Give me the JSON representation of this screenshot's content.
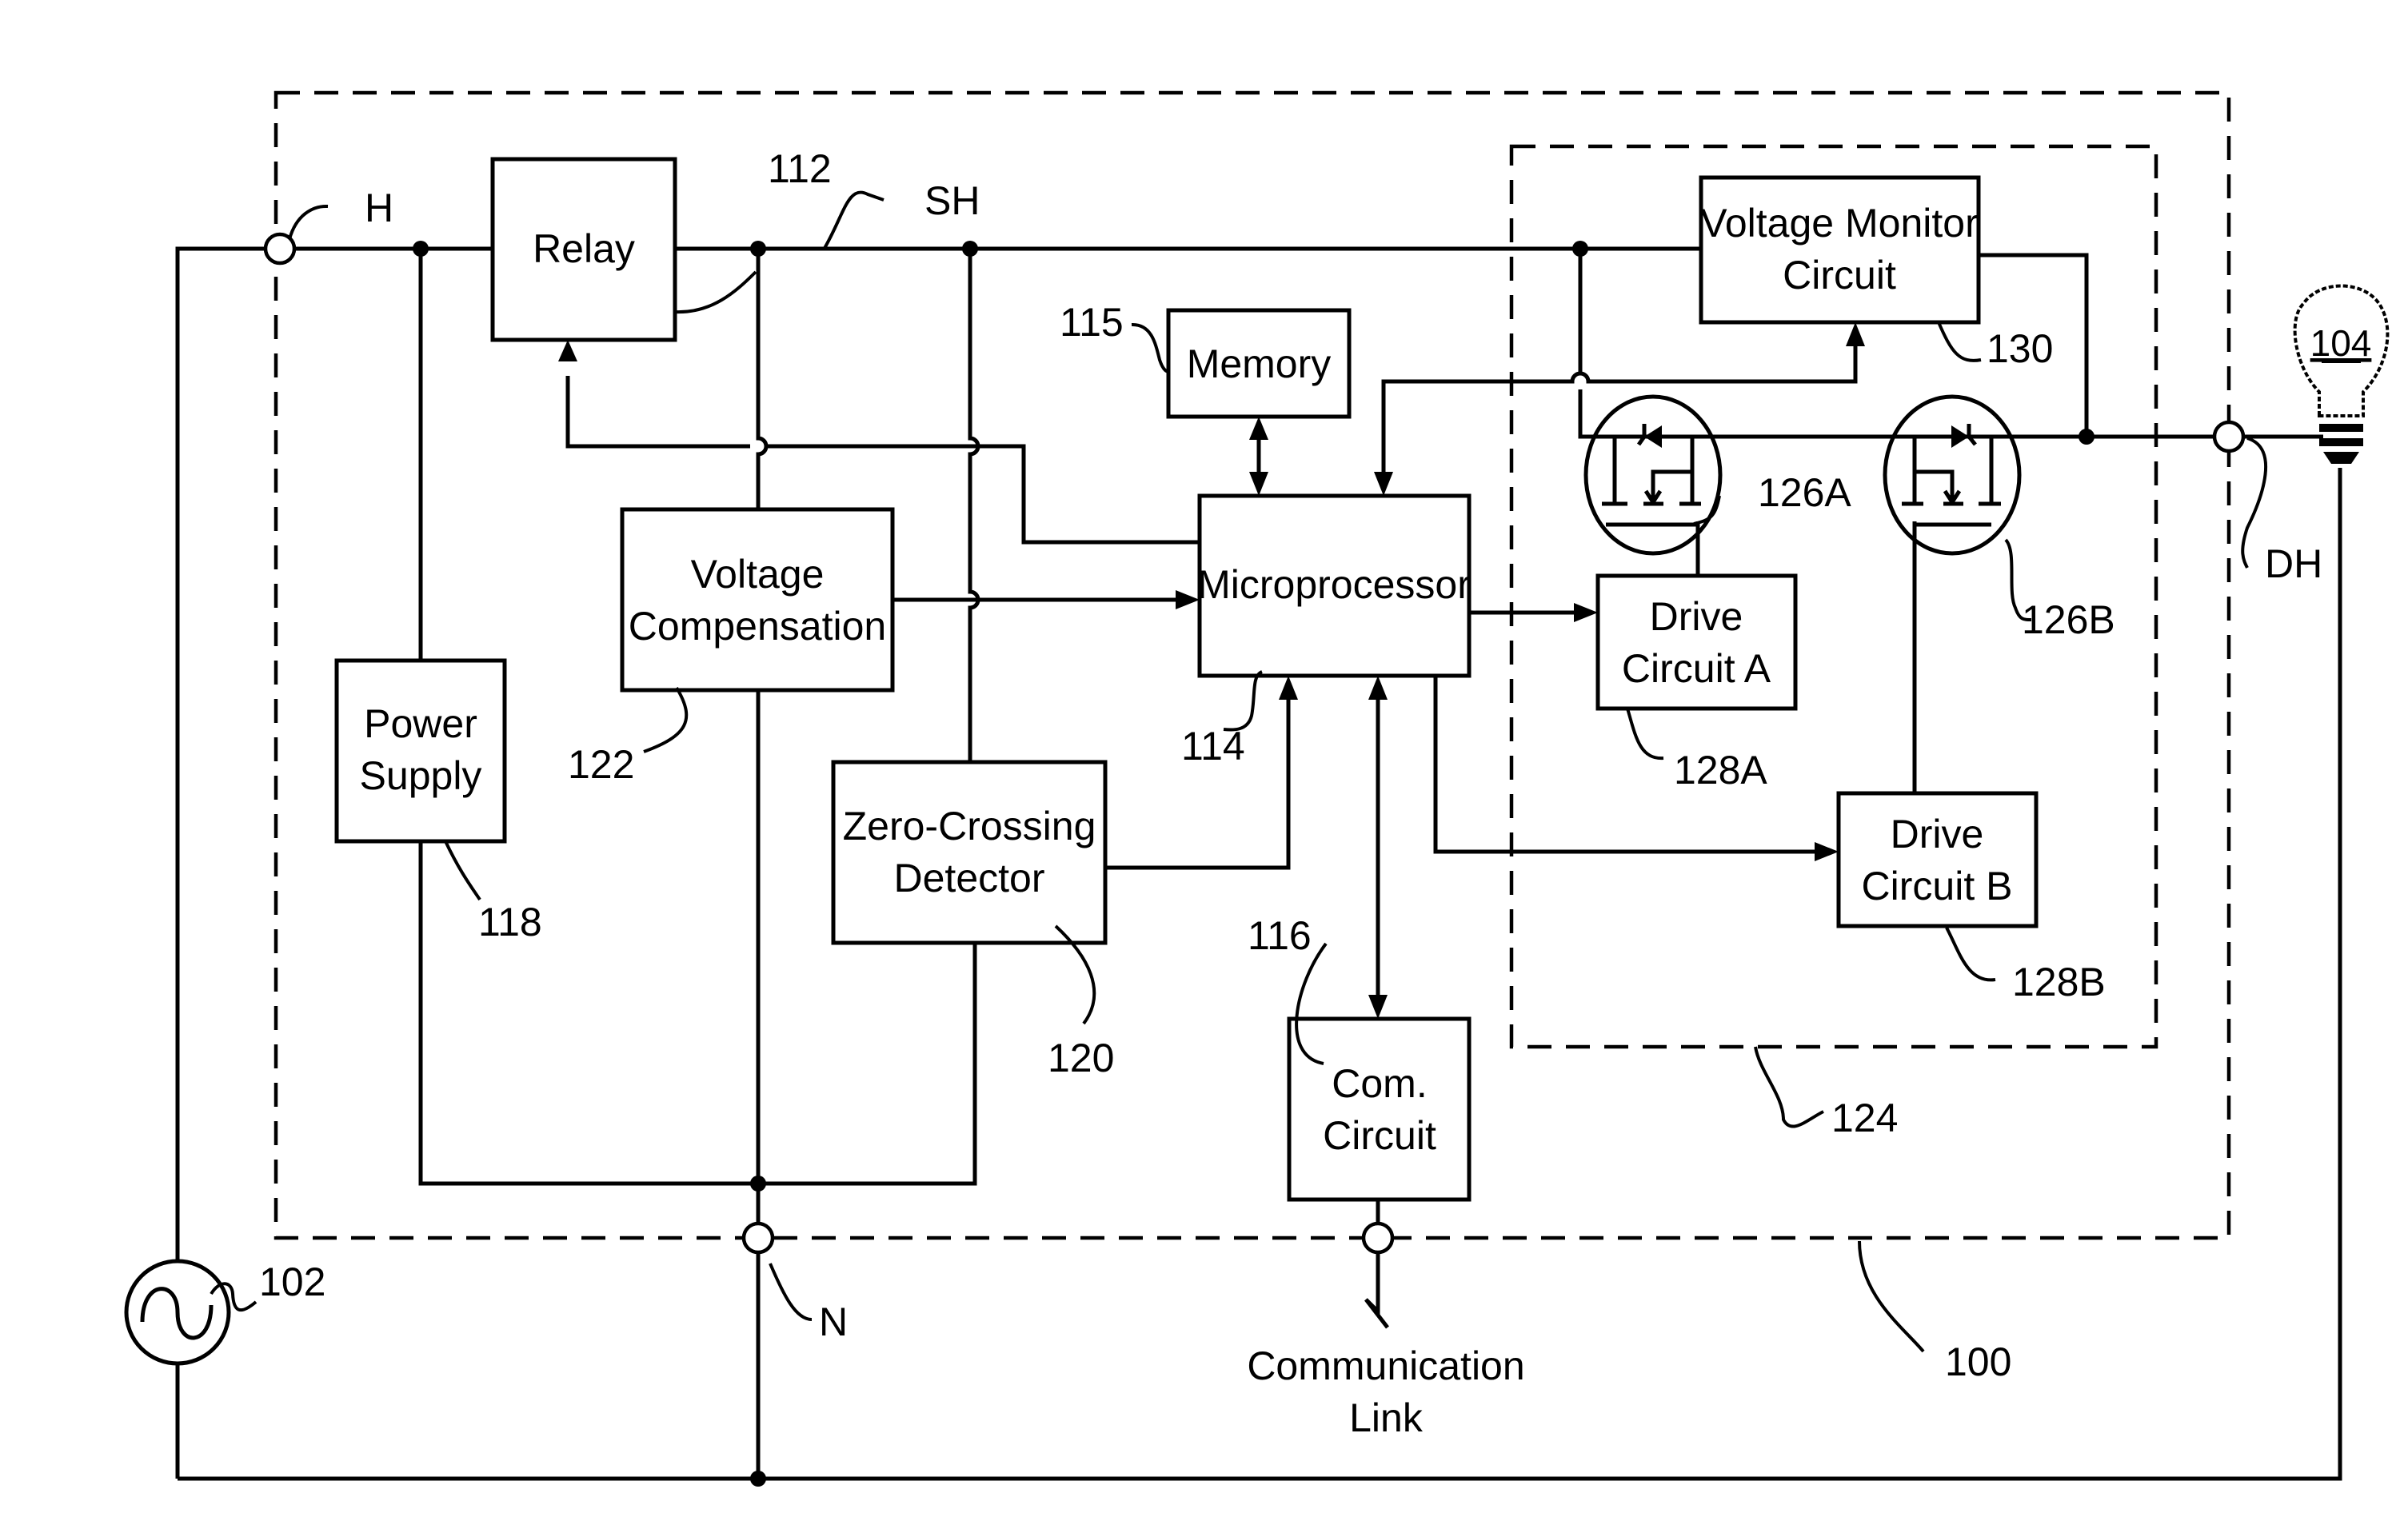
{
  "figure": {
    "device_ref": "100",
    "blocks": {
      "relay": {
        "label": "Relay",
        "ref": "112"
      },
      "memory": {
        "label": "Memory",
        "ref": "115"
      },
      "microprocessor": {
        "label": "Microprocessor",
        "ref": "114"
      },
      "voltage_compensation": {
        "line1": "Voltage",
        "line2": "Compensation",
        "ref": "122"
      },
      "power_supply": {
        "line1": "Power",
        "line2": "Supply",
        "ref": "118"
      },
      "zero_crossing": {
        "line1": "Zero-Crossing",
        "line2": "Detector",
        "ref": "120"
      },
      "com_circuit": {
        "line1": "Com.",
        "line2": "Circuit",
        "ref": "116"
      },
      "voltage_monitor": {
        "line1": "Voltage Monitor",
        "line2": "Circuit",
        "ref": "130"
      },
      "drive_a": {
        "line1": "Drive",
        "line2": "Circuit A",
        "ref": "128A"
      },
      "drive_b": {
        "line1": "Drive",
        "line2": "Circuit B",
        "ref": "128B"
      }
    },
    "switches": {
      "mosfet_a_ref": "126A",
      "mosfet_b_ref": "126B",
      "group_ref": "124"
    },
    "terminals": {
      "hot": "H",
      "switched_hot": "SH",
      "neutral": "N",
      "dimmed_hot": "DH"
    },
    "source_ref": "102",
    "load_ref": "104",
    "communication_link": {
      "line1": "Communication",
      "line2": "Link"
    }
  }
}
